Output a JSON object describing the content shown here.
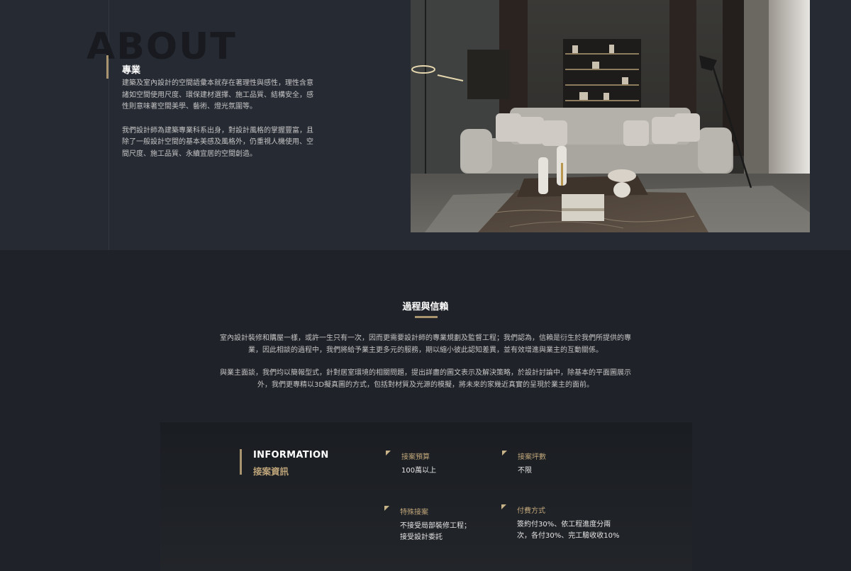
{
  "about": {
    "bg_word": "ABOUT",
    "title": "專業",
    "paragraphs": [
      "建築及室內設計的空間語彙本就存在著理性與感性，理性含意諸如空間使用尺度、環保建材選擇、施工品質、結構安全，感性則意味著空間美學、藝術、燈光氛圍等。",
      "我們設計師為建築專業科系出身，對設計風格的掌握豐富，且除了一般設計空間的基本美感及風格外，仍重視人機使用、空間尺度、施工品質、永續宜居的空間創造。"
    ],
    "photo_icon": "living-room-photo"
  },
  "process": {
    "title": "過程與信賴",
    "paragraphs": [
      "室內設計裝修和購屋一樣，或許一生只有一次，因而更需要設計師的專業規劃及監督工程；我們認為，信賴是衍生於我們所提供的專業，因此相談的過程中，我們將給予業主更多元的服務，期以縮小彼此認知差異，並有效增進與業主的互動關係。",
      "與業主面談，我們均以簡報型式，針對居室環境的相關問題，提出詳盡的圖文表示及解決策略，於設計討論中，除基本的平面圖展示外，我們更專精以3D擬真圖的方式，包括對材質及光源的模擬，將未來的家幾近真實的呈現於業主的面前。"
    ]
  },
  "info": {
    "title_en": "INFORMATION",
    "title_zh": "接案資訊",
    "fields": [
      {
        "label": "接案預算",
        "value": "100萬以上"
      },
      {
        "label": "接案坪數",
        "value": "不限"
      },
      {
        "label": "特殊接案",
        "value": "不接受局部裝修工程；\n接受設計委託"
      },
      {
        "label": "付費方式",
        "value": "簽約付30%、依工程進度分兩\n次，各付30%、完工驗收收10%"
      }
    ]
  },
  "colors": {
    "accent": "#a8946f",
    "about_bg": "#262a33",
    "page_bg": "#1f2228"
  }
}
